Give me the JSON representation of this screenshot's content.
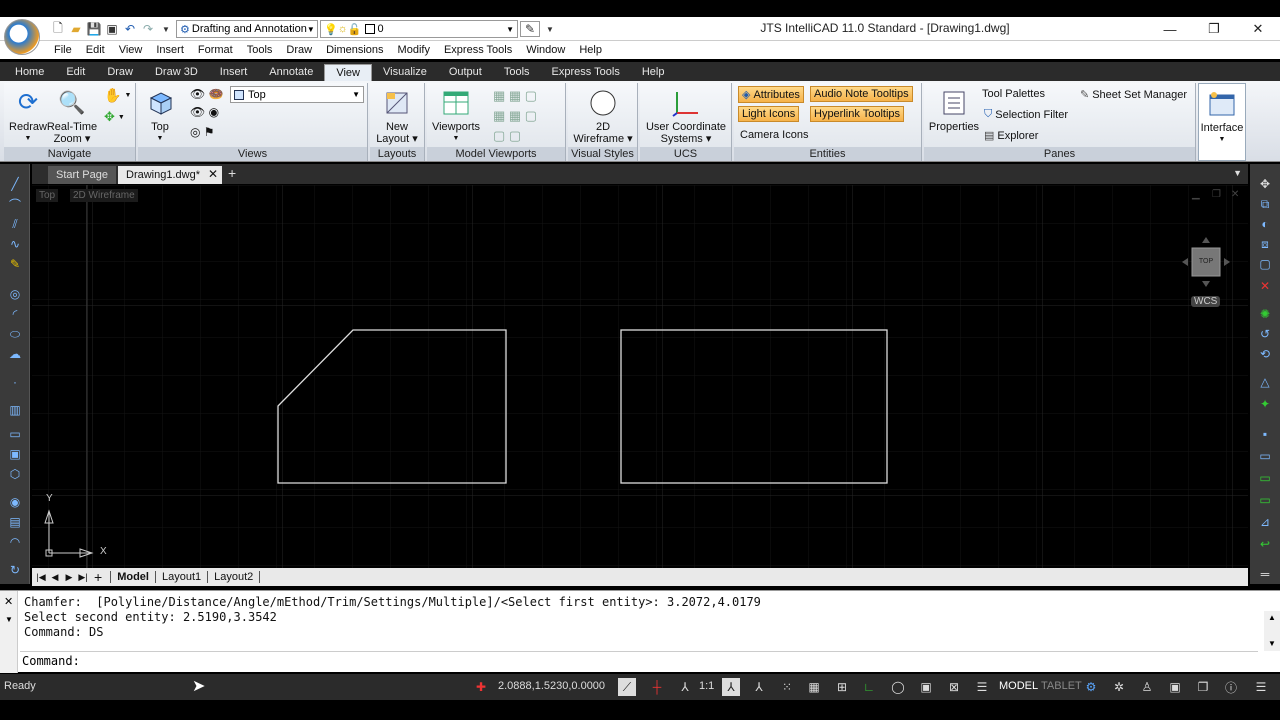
{
  "app": {
    "title": "JTS IntelliCAD 11.0 Standard - [Drawing1.dwg]",
    "workspace": "Drafting and Annotation",
    "layer_value": "0"
  },
  "menu": [
    "File",
    "Edit",
    "View",
    "Insert",
    "Format",
    "Tools",
    "Draw",
    "Dimensions",
    "Modify",
    "Express Tools",
    "Window",
    "Help"
  ],
  "ribbon_tabs": [
    "Home",
    "Edit",
    "Draw",
    "Draw 3D",
    "Insert",
    "Annotate",
    "View",
    "Visualize",
    "Output",
    "Tools",
    "Express Tools",
    "Help"
  ],
  "ribbon": {
    "navigate": {
      "title": "Navigate",
      "redraw": "Redraw",
      "realtime": "Real-Time",
      "zoom": "Zoom"
    },
    "views": {
      "title": "Views",
      "top_btn": "Top",
      "view_combo": "Top"
    },
    "layouts": {
      "title": "Layouts",
      "new_layout_1": "New",
      "new_layout_2": "Layout"
    },
    "model_viewports": {
      "title": "Model Viewports",
      "viewports": "Viewports"
    },
    "visual_styles": {
      "title": "Visual Styles",
      "style_1": "2D",
      "style_2": "Wireframe"
    },
    "ucs": {
      "title": "UCS",
      "btn_1": "User Coordinate",
      "btn_2": "Systems"
    },
    "entities": {
      "title": "Entities",
      "attributes": "Attributes",
      "audio": "Audio Note Tooltips",
      "light": "Light Icons",
      "hyperlink": "Hyperlink Tooltips",
      "camera": "Camera Icons"
    },
    "panes": {
      "title": "Panes",
      "properties": "Properties",
      "tool_palettes": "Tool Palettes",
      "sheet_set": "Sheet Set Manager",
      "selection_filter": "Selection Filter",
      "explorer": "Explorer"
    },
    "interface": {
      "label": "Interface"
    }
  },
  "doc_tabs": [
    "Start Page",
    "Drawing1.dwg*"
  ],
  "viewport": {
    "view": "Top",
    "style": "2D Wireframe",
    "cube_label": "TOP",
    "wcs": "WCS",
    "axis_x": "X",
    "axis_y": "Y"
  },
  "layout_tabs": [
    "Model",
    "Layout1",
    "Layout2"
  ],
  "command": {
    "history": [
      "Chamfer:  [Polyline/Distance/Angle/mEthod/Trim/Settings/Multiple]/<Select first entity>: 3.2072,4.0179",
      "Select second entity: 2.5190,3.3542",
      "Command: DS"
    ],
    "prompt": "Command:"
  },
  "status": {
    "ready": "Ready",
    "coords": "2.0888,1.5230,0.0000",
    "scale": "1:1",
    "model": "MODEL",
    "tablet": "TABLET"
  }
}
